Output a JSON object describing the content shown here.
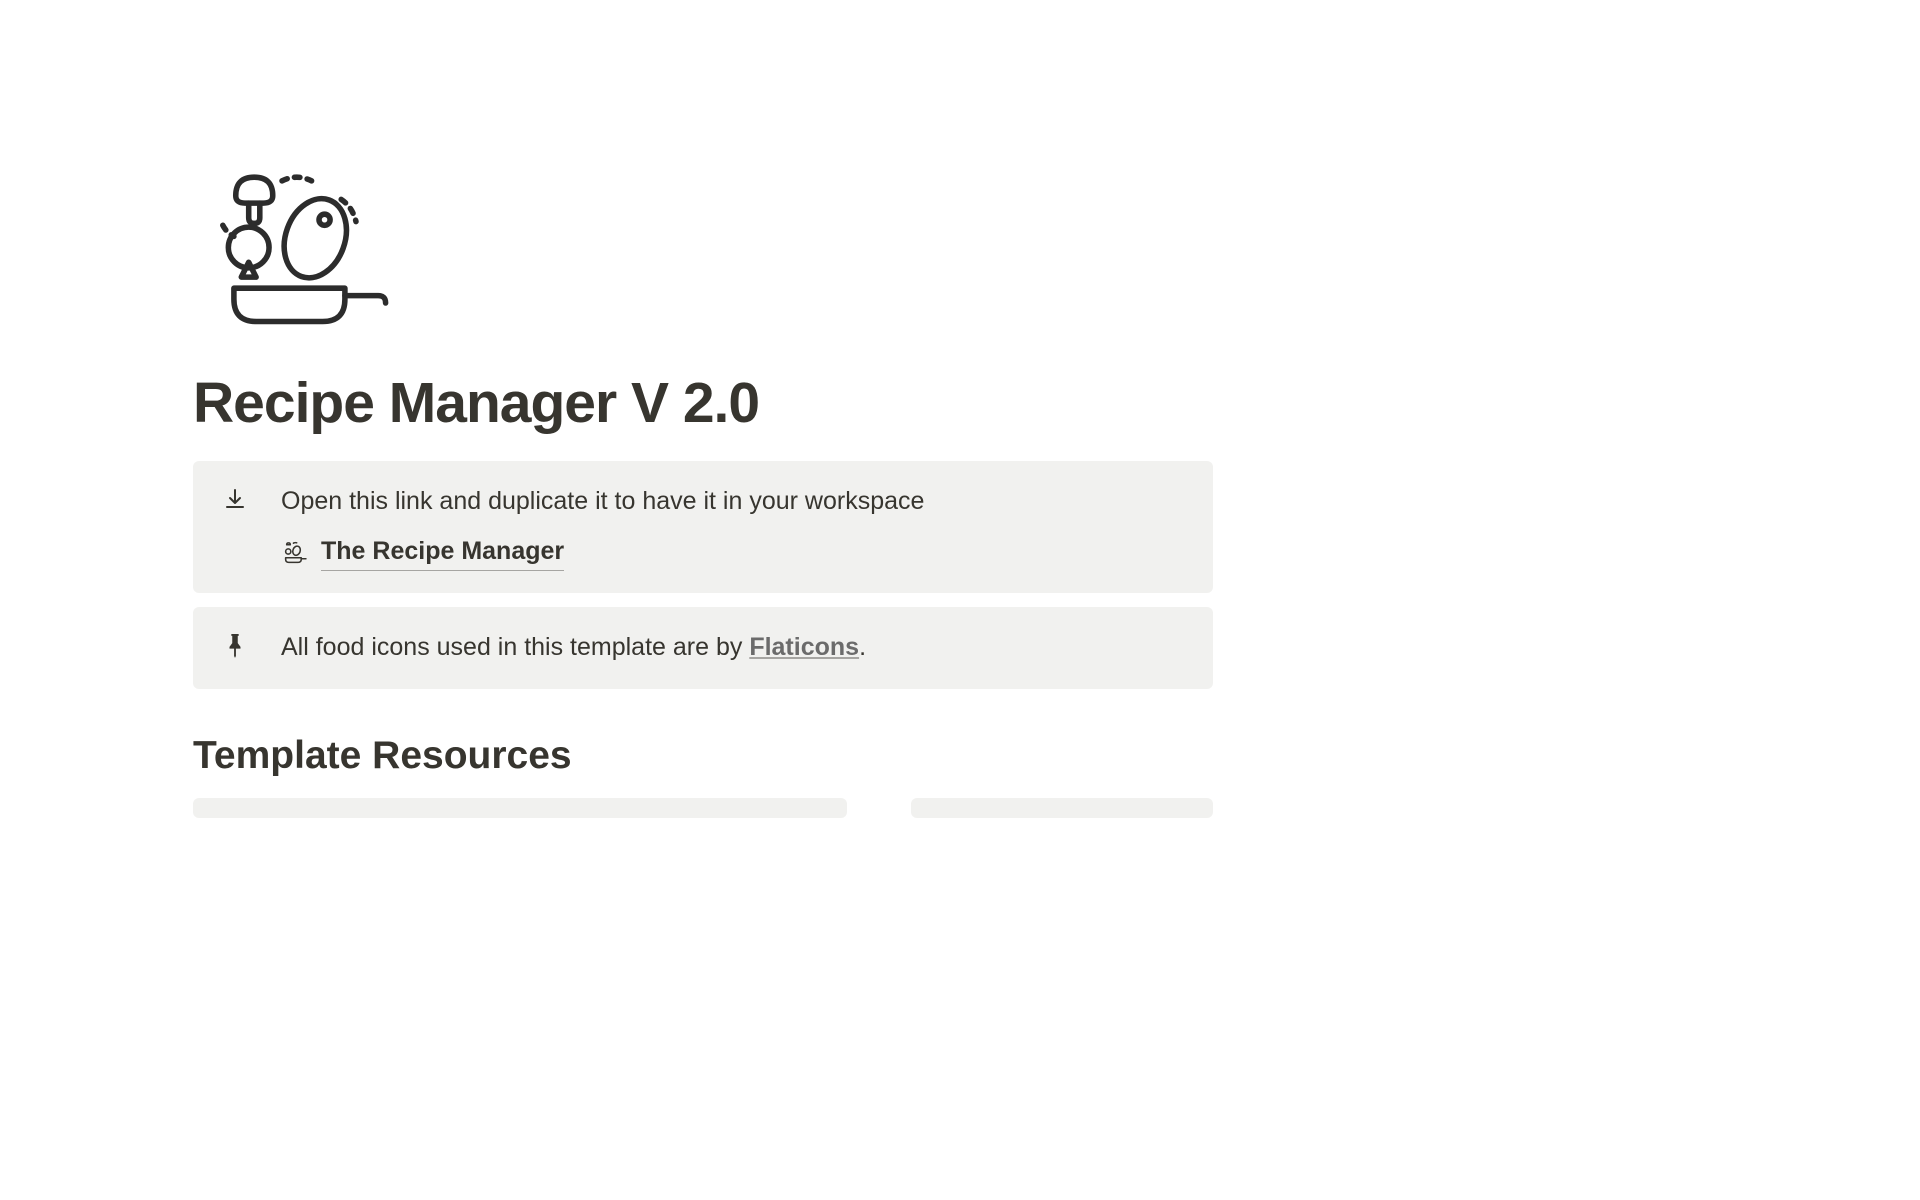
{
  "page": {
    "title": "Recipe Manager V 2.0"
  },
  "callouts": [
    {
      "text": "Open this link and duplicate it to have it in your workspace",
      "link_label": "The Recipe Manager"
    },
    {
      "text_before": "All food icons used in this template are by ",
      "link_label": "Flaticons",
      "text_after": "."
    }
  ],
  "section": {
    "heading": "Template Resources"
  }
}
